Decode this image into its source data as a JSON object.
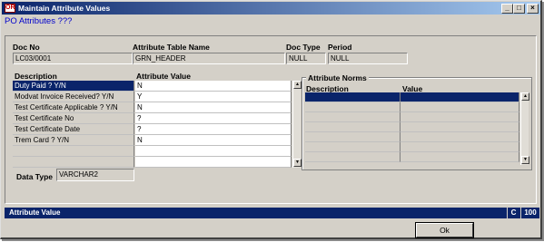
{
  "window": {
    "title": "Maintain Attribute Values",
    "icon_glyph": "OR",
    "controls": {
      "minimize": "_",
      "maximize": "□",
      "close": "×"
    }
  },
  "form": {
    "heading": "PO Attributes ???",
    "labels": {
      "doc_no": "Doc No",
      "attribute_table_name": "Attribute Table Name",
      "doc_type": "Doc Type",
      "period": "Period",
      "description": "Description",
      "attribute_value": "Attribute Value",
      "data_type": "Data Type"
    },
    "values": {
      "doc_no": "LC03/0001",
      "attribute_table_name": "GRN_HEADER",
      "doc_type": "NULL",
      "period": "NULL",
      "data_type": "VARCHAR2"
    }
  },
  "attributes": {
    "rows": [
      {
        "description": "Duty Paid ? Y/N",
        "value": "N",
        "active": true
      },
      {
        "description": "Modvat Invoice Received? Y/N",
        "value": "Y",
        "active": false
      },
      {
        "description": "Test Certificate Applicable ? Y/N",
        "value": "N",
        "active": false
      },
      {
        "description": "Test Certificate No",
        "value": "?",
        "active": false
      },
      {
        "description": "Test Certificate Date",
        "value": "?",
        "active": false
      },
      {
        "description": "Trem Card ? Y/N",
        "value": "N",
        "active": false
      },
      {
        "description": "",
        "value": "",
        "active": false
      },
      {
        "description": "",
        "value": "",
        "active": false
      }
    ]
  },
  "norms": {
    "title": "Attribute Norms",
    "columns": {
      "description": "Description",
      "value": "Value"
    },
    "row_count": 8,
    "active_row": 0
  },
  "status": {
    "text": "Attribute Value",
    "mode": "C",
    "count": "100"
  },
  "buttons": {
    "ok": "Ok"
  },
  "colors": {
    "title_gradient_start": "#0a246a",
    "title_gradient_end": "#a6caf0",
    "heading": "#0000cc",
    "selection": "#0a246a",
    "face": "#d4d0c8"
  },
  "icons": {
    "scroll_up": "scroll-up-icon",
    "scroll_down": "scroll-down-icon"
  }
}
